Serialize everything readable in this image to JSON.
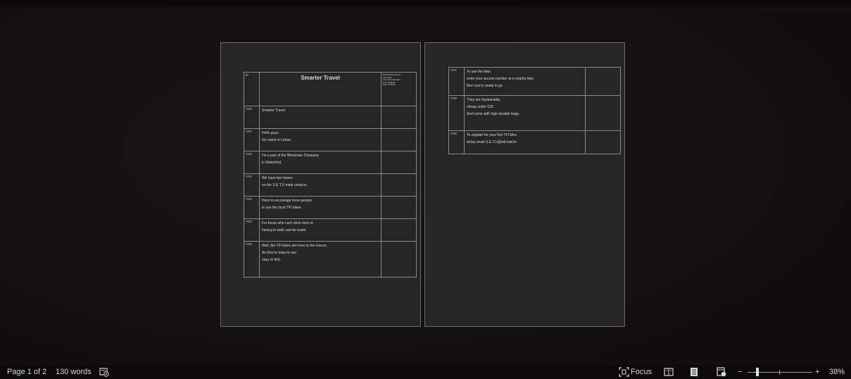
{
  "document": {
    "page1": {
      "title": "Smarter Travel",
      "header_id": "ID",
      "meta_lines": [
        "DURATION: 00 secs",
        "VO: Male",
        "Tone: Informational",
        "Pace: medium",
        "TAT: 12/08/2X"
      ],
      "rows": [
        {
          "id": "VO00",
          "lines": [
            "Smarter Travel"
          ]
        },
        {
          "id": "VO01",
          "lines": [
            "Hello guys,",
            "my name is Lekan."
          ]
        },
        {
          "id": "VO02",
          "lines": [
            "I'm a part of the Bikeshare Company",
            "in Waterford."
          ]
        },
        {
          "id": "VO03",
          "lines": [
            "We have two bases",
            " on the S.E.T.U main campus."
          ]
        },
        {
          "id": "VO04",
          "lines": [
            "Here to encourage more people,",
            " to use the local TFI bikes."
          ]
        },
        {
          "id": "VO05",
          "lines": [
            "For those who can't drive tired of,",
            "having to walk narrow roads."
          ]
        },
        {
          "id": "VO06",
          "lines": [
            "Well, the TFI bikes are here to the rescue.",
            "As they're easy to use.",
            "easy to find."
          ]
        }
      ]
    },
    "page2": {
      "rows": [
        {
          "id": "VO07",
          "lines": [
            "To use the bike,",
            "enter your access number at a nearby bike,",
            "then you're ready to go"
          ]
        },
        {
          "id": "VO08",
          "lines": [
            " They are Sustainable,",
            "cheap under €20.",
            "And come with high durable bags,"
          ]
        },
        {
          "id": "VO09",
          "lines": [
            "To register for your first TFI bike,",
            "today email S.E.T.U@wit.mail.ie"
          ]
        }
      ]
    }
  },
  "statusbar": {
    "page_info": "Page 1 of 2",
    "word_count": "130 words",
    "focus_label": "Focus",
    "zoom_minus": "−",
    "zoom_plus": "+",
    "zoom_level": "38%",
    "zoom_fraction": 0.38
  },
  "colors": {
    "page_bg": "#262626",
    "page_border": "#6b6b6b",
    "statusbar_bg": "#0d0a0b"
  }
}
